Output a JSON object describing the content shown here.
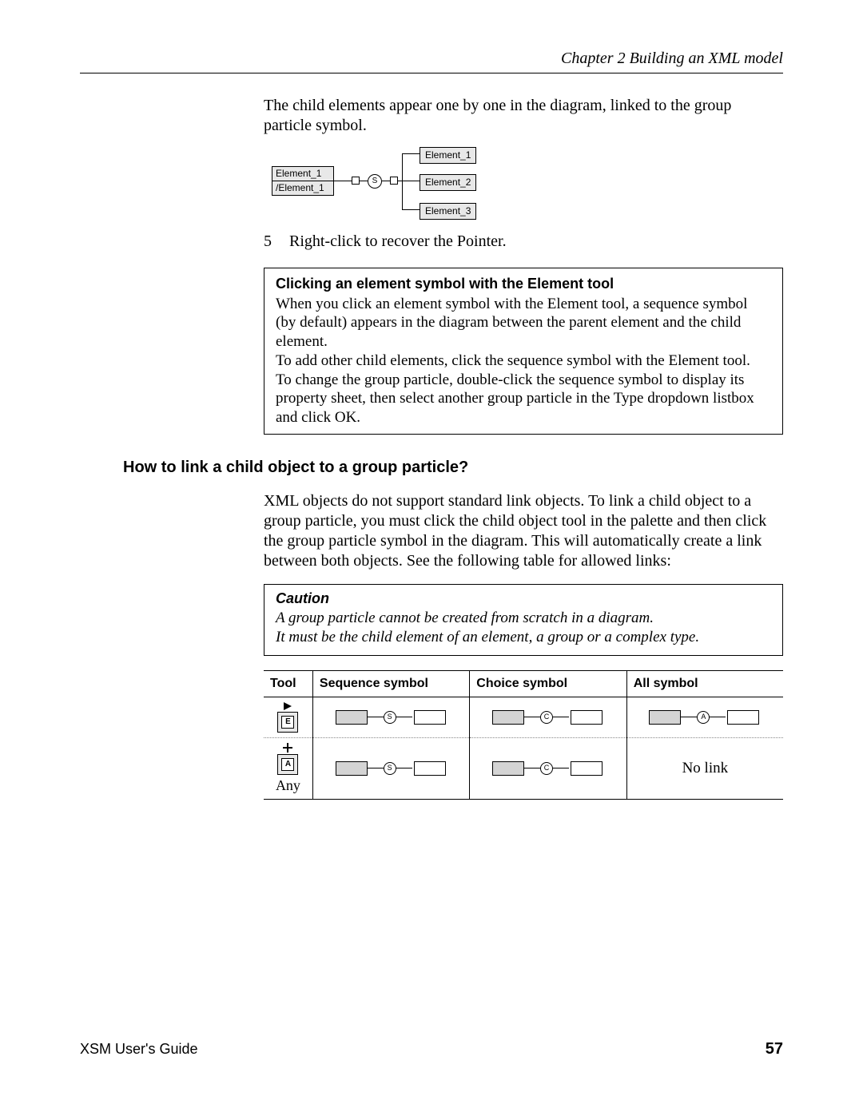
{
  "header": {
    "chapter_line": "Chapter 2  Building an XML model"
  },
  "body": {
    "intro_para": "The child elements appear one by one in the diagram, linked to the group particle symbol.",
    "diagram1": {
      "parent_top": "Element_1",
      "parent_bottom": "/Element_1",
      "seq_letter": "S",
      "child1": "Element_1",
      "child2": "Element_2",
      "child3": "Element_3"
    },
    "step5_num": "5",
    "step5_text": "Right-click to recover the Pointer.",
    "infobox": {
      "title": "Clicking an element symbol with the Element tool",
      "p1": "When you click an element symbol with the Element tool, a sequence symbol (by default) appears in the diagram between the parent element and the child element.",
      "p2": "To add other child elements, click the sequence symbol with the Element tool.",
      "p3": "To change the group particle, double-click the sequence symbol to display its property sheet, then select another group particle in the Type dropdown listbox and click OK."
    }
  },
  "section": {
    "heading": "How to link a child object to a group particle?",
    "para": "XML objects do not support standard link objects. To link a child object to a group particle, you must click the child object tool in the palette and then click the group particle symbol in the diagram. This will automatically create a link between both objects. See the following table for allowed links:",
    "caution": {
      "title": "Caution",
      "line1": "A group particle cannot be created from scratch in a diagram.",
      "line2": "It must be the child element of an element, a group or a complex type."
    }
  },
  "table": {
    "headers": {
      "c1": "Tool",
      "c2": "Sequence symbol",
      "c3": "Choice symbol",
      "c4": "All symbol"
    },
    "row1": {
      "tool_letter": "E",
      "seq_letter": "S",
      "choice_letter": "C",
      "all_letter": "A"
    },
    "row2": {
      "tool_letter": "A",
      "tool_caption": "Any",
      "seq_letter": "S",
      "choice_letter": "C",
      "all_text": "No link"
    }
  },
  "footer": {
    "doc_title": "XSM User's Guide",
    "page_number": "57"
  }
}
